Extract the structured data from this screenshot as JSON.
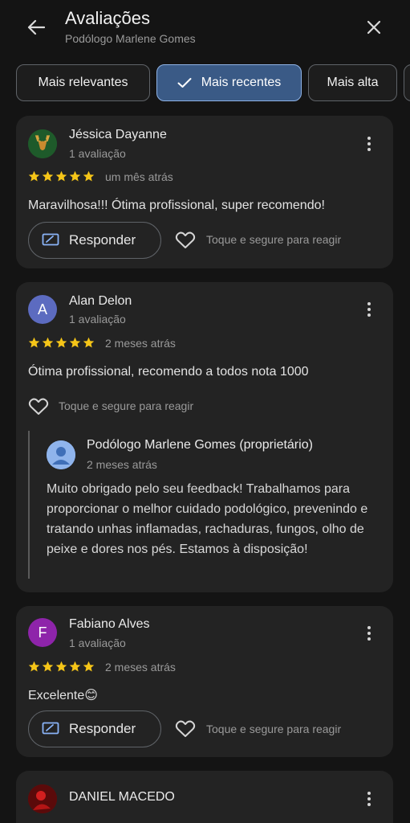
{
  "header": {
    "title": "Avaliações",
    "subtitle": "Podólogo Marlene Gomes"
  },
  "chips": [
    {
      "label": "Mais relevantes",
      "selected": false
    },
    {
      "label": "Mais recentes",
      "selected": true
    },
    {
      "label": "Mais alta",
      "selected": false
    }
  ],
  "reviews": [
    {
      "name": "Jéssica Dayanne",
      "count": "1 avaliação",
      "rating": 5,
      "when": "um mês atrás",
      "text": "Maravilhosa!!! Ótima profissional, super recomendo!",
      "respond_label": "Responder",
      "react_hint": "Toque e segure para reagir",
      "avatar_icon": "deer-icon"
    },
    {
      "name": "Alan Delon",
      "count": "1 avaliação",
      "rating": 5,
      "when": "2 meses atrás",
      "text": "Ótima profissional, recomendo a todos nota 1000",
      "react_hint": "Toque e segure para reagir",
      "avatar_letter": "A",
      "avatar_color": "#5c6bc0",
      "owner": {
        "name": "Podólogo Marlene Gomes (proprietário)",
        "when": "2 meses atrás",
        "text": "Muito obrigado pelo seu feedback! Trabalhamos para proporcionar o melhor cuidado podológico, prevenindo e tratando unhas inflamadas, rachaduras, fungos, olho de peixe e dores nos pés. Estamos à disposição!"
      }
    },
    {
      "name": "Fabiano Alves",
      "count": "1 avaliação",
      "rating": 5,
      "when": "2 meses atrás",
      "text": "Excelente😊",
      "respond_label": "Responder",
      "react_hint": "Toque e segure para reagir",
      "avatar_letter": "F",
      "avatar_color": "#8e24aa"
    },
    {
      "name": "DANIEL MACEDO"
    }
  ],
  "colors": {
    "star": "#f5c518",
    "chip_selected": "#3a5a86"
  }
}
